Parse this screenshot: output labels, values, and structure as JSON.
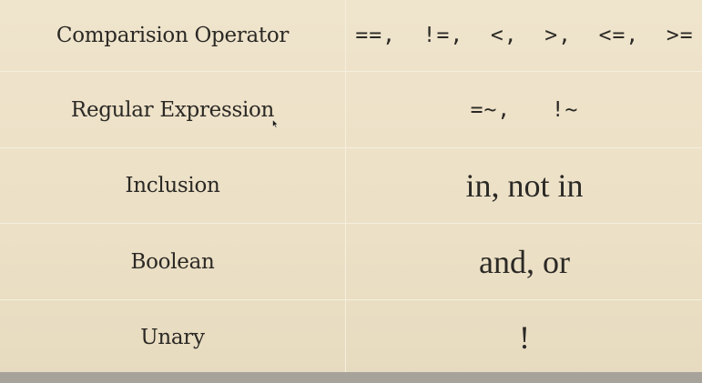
{
  "rows": [
    {
      "name": "Comparision Operator",
      "value": "==,  !=,  <,  >,  <=,  >="
    },
    {
      "name": "Regular Expression",
      "value": "=~,   !~"
    },
    {
      "name": "Inclusion",
      "value": "in, not in"
    },
    {
      "name": "Boolean",
      "value": "and, or"
    },
    {
      "name": "Unary",
      "value": "!"
    }
  ],
  "colors": {
    "background": "#ece0c6",
    "grid_line": "#f6efdf",
    "text": "#2b2925",
    "bottom_strip": "#a7a39a"
  },
  "icons": {
    "cursor": "mouse-pointer-icon"
  }
}
